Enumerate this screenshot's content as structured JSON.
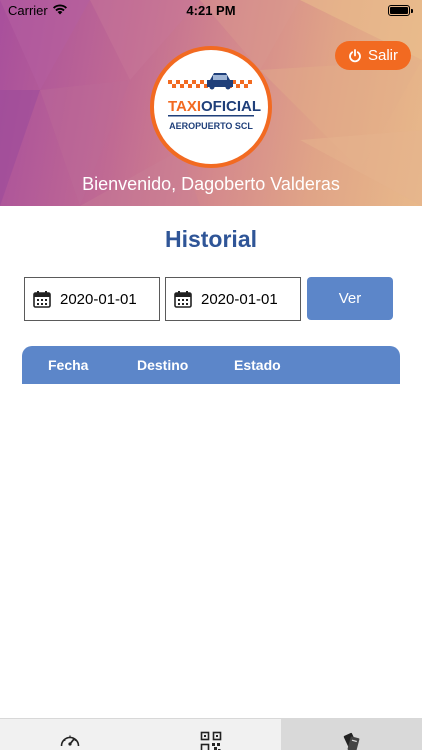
{
  "status_bar": {
    "carrier": "Carrier",
    "time": "4:21 PM"
  },
  "header": {
    "logout_label": "Salir",
    "welcome_text": "Bienvenido, Dagoberto Valderas",
    "logo": {
      "brand_text_1": "TAXI",
      "brand_text_2": "OFICIAL",
      "subtitle": "AEROPUERTO SCL"
    }
  },
  "main": {
    "title": "Historial",
    "start_date": "2020-01-01",
    "end_date": "2020-01-01",
    "submit_label": "Ver",
    "table": {
      "columns": [
        "Fecha",
        "Destino",
        "Estado"
      ],
      "rows": []
    }
  },
  "tab_bar": {
    "tabs": [
      {
        "icon": "speedometer-icon",
        "selected": false
      },
      {
        "icon": "qr-code-icon",
        "selected": false
      },
      {
        "icon": "history-icon",
        "selected": true
      }
    ]
  },
  "colors": {
    "accent_blue": "#2f5597",
    "button_blue": "#5c86c9",
    "brand_orange": "#f26a21"
  }
}
